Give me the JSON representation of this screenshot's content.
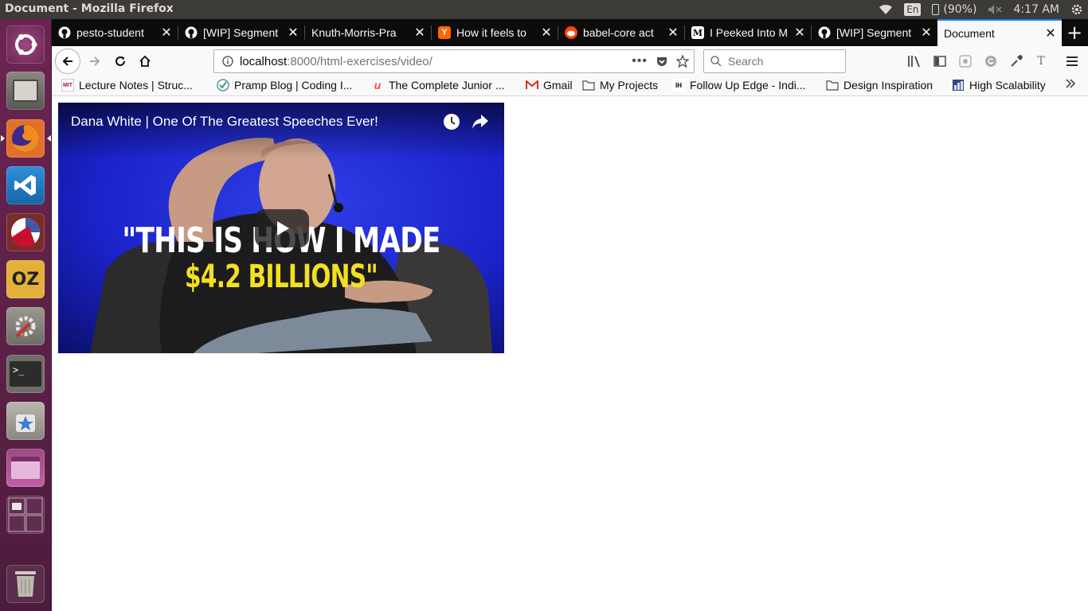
{
  "window": {
    "title": "Document - Mozilla Firefox"
  },
  "tray": {
    "lang": "En",
    "battery": "(90%)",
    "time": "4:17 AM"
  },
  "launcher": {
    "items": [
      {
        "name": "ubuntu-dash-icon"
      },
      {
        "name": "files-icon"
      },
      {
        "name": "firefox-icon"
      },
      {
        "name": "vscode-icon"
      },
      {
        "name": "racket-icon"
      },
      {
        "name": "oz-icon"
      },
      {
        "name": "system-settings-icon"
      },
      {
        "name": "terminal-icon"
      },
      {
        "name": "software-center-icon"
      },
      {
        "name": "app-window-icon"
      },
      {
        "name": "workspace-switcher-icon"
      },
      {
        "name": "trash-icon"
      }
    ]
  },
  "tabs": [
    {
      "label": "pesto-student",
      "favicon": "github-icon",
      "color": "#0c0c0d"
    },
    {
      "label": "[WIP] Segment",
      "favicon": "github-icon",
      "color": "#0c0c0d"
    },
    {
      "label": "Knuth-Morris-Pra",
      "favicon": "none",
      "color": "#0c0c0d"
    },
    {
      "label": "How it feels to",
      "favicon": "ycombinator-icon",
      "color": "#ff6600"
    },
    {
      "label": "babel-core act",
      "favicon": "reddit-icon",
      "color": "#ff4500"
    },
    {
      "label": "I Peeked Into M",
      "favicon": "medium-icon",
      "color": "#000000"
    },
    {
      "label": "[WIP] Segment",
      "favicon": "github-icon",
      "color": "#0c0c0d"
    },
    {
      "label": "Document",
      "favicon": "none",
      "color": "#f9f9fa"
    }
  ],
  "navbar": {
    "url_host": "localhost",
    "url_path": ":8000/html-exercises/video/",
    "search_placeholder": "Search"
  },
  "bookmarks": [
    {
      "label": "Lecture Notes | Struc...",
      "icon": "mit-ocw-icon"
    },
    {
      "label": "Pramp Blog | Coding I...",
      "icon": "pramp-icon"
    },
    {
      "label": "The Complete Junior ...",
      "icon": "udemy-icon"
    },
    {
      "label": "Gmail",
      "icon": "gmail-icon"
    },
    {
      "label": "My Projects",
      "icon": "folder-icon"
    },
    {
      "label": "Follow Up Edge - Indi...",
      "icon": "followupedge-icon"
    },
    {
      "label": "Design Inspiration",
      "icon": "folder-icon"
    },
    {
      "label": "High Scalability",
      "icon": "highscalability-icon"
    }
  ],
  "video": {
    "title": "Dana White | One Of The Greatest Speeches Ever!",
    "headline_line1": "\"THIS IS HOW I MADE",
    "headline_line2": "$4.2 BILLIONS\""
  }
}
